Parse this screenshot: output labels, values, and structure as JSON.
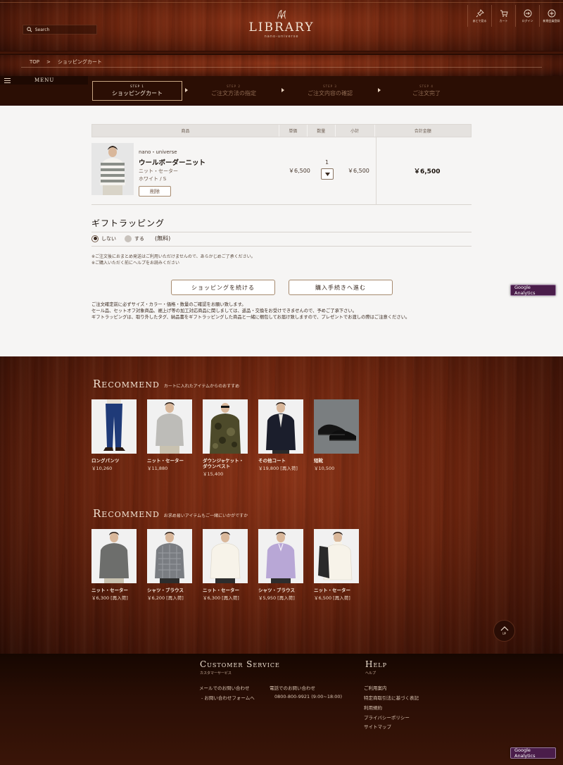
{
  "header": {
    "search_placeholder": "Search",
    "logo_text": "LIBRARY",
    "logo_sub": "nano-universe",
    "nav": [
      {
        "label": "あとで見る"
      },
      {
        "label": "カート"
      },
      {
        "label": "ログイン"
      },
      {
        "label": "新規会員登録"
      }
    ]
  },
  "breadcrumb": {
    "home": "TOP",
    "sep": ">",
    "current": "ショッピングカート"
  },
  "menu": {
    "label": "MENU"
  },
  "steps": [
    {
      "num": "STEP 1",
      "label": "ショッピングカート"
    },
    {
      "num": "STEP 2",
      "label": "ご注文方法の指定"
    },
    {
      "num": "STEP 3",
      "label": "ご注文内容の確認"
    },
    {
      "num": "STEP 4",
      "label": "ご注文完了"
    }
  ],
  "cart": {
    "headers": [
      "商品",
      "単価",
      "数量",
      "小計",
      "合計金額"
    ],
    "item": {
      "brand": "nano・universe",
      "name": "ウールボーダーニット",
      "category": "ニット・セーター",
      "variant": "ホワイト / S",
      "delete_label": "削除",
      "unit_price": "￥6,500",
      "quantity": "1",
      "subtotal": "￥6,500"
    },
    "total": "￥6,500"
  },
  "gift": {
    "title": "ギフトラッピング",
    "option_none": "しない",
    "option_wrap": "する",
    "fee": "(無料)",
    "selected": "しない",
    "note1": "※ご注文後におまとめ発送はご利用いただけませんので、あらかじめご了承ください。",
    "note2": "※ご購入いただく前にヘルプをお読みください"
  },
  "buttons": {
    "continue_shopping": "ショッピングを続ける",
    "checkout": "購入手続きへ進む"
  },
  "notice": {
    "line1": "ご注文確定前に必ずサイズ・カラー・価格・数量のご確認をお願い致します。",
    "line2": "セール品、セットオフ対象商品、裾上げ等の加工対応商品に関しましては、返品・交換をお受けできませんので、予めご了承下さい。",
    "line3": "ギフトラッピングは、取り外したタグ、納品書をギフトラッピングした商品と一緒に梱包してお届け致しますので、プレゼントでお渡しの際はご注意ください。"
  },
  "analytics_label": "Google Analytics",
  "recommend1": {
    "title": "Recommend",
    "subtitle": "カートに入れたアイテムからのおすすめ",
    "items": [
      {
        "name": "ロングパンツ",
        "price": "￥10,260",
        "icon": "pants"
      },
      {
        "name": "ニット・セーター",
        "price": "￥11,880",
        "icon": "sweater-gray"
      },
      {
        "name": "ダウンジャケット・ダウンベスト",
        "price": "￥15,400",
        "icon": "camo-jacket"
      },
      {
        "name": "その他コート",
        "price": "￥19,800 [再入荷]",
        "icon": "navy-coat"
      },
      {
        "name": "短靴",
        "price": "￥10,500",
        "icon": "black-shoes"
      }
    ]
  },
  "recommend2": {
    "title": "Recommend",
    "subtitle": "お求め易いアイテムもご一緒にいかがですか",
    "items": [
      {
        "name": "ニット・セーター",
        "price": "￥6,300 [再入荷]",
        "icon": "gray-knit"
      },
      {
        "name": "シャツ・ブラウス",
        "price": "￥6,200 [再入荷]",
        "icon": "check-shirt"
      },
      {
        "name": "ニット・セーター",
        "price": "￥6,300 [再入荷]",
        "icon": "white-knit"
      },
      {
        "name": "シャツ・ブラウス",
        "price": "￥5,950 [再入荷]",
        "icon": "lavender-shirt"
      },
      {
        "name": "ニット・セーター",
        "price": "￥6,500 [再入荷]",
        "icon": "white-turtleneck"
      }
    ]
  },
  "up_label": "UP",
  "footer": {
    "cs_title": "Customer Service",
    "cs_sub": "カスタマーサービス",
    "mail_label": "メールでのお問い合わせ",
    "mail_link": "- お問い合わせフォームへ",
    "phone_label": "電話でのお問い合わせ",
    "phone_value": "0800-800-9921 (9:00~18:00)",
    "help_title": "Help",
    "help_sub": "ヘルプ",
    "help_links": [
      "ご利用案内",
      "特定商取引法に基づく表記",
      "利用規約",
      "プライバシーポリシー",
      "サイトマップ"
    ]
  },
  "colors": {
    "wood_dark": "#3a1308",
    "wood_mid": "#6a230d",
    "content_bg": "#f6f5f4",
    "accent_border": "#a68a6e",
    "analytics_bg": "#4a1d4a"
  }
}
